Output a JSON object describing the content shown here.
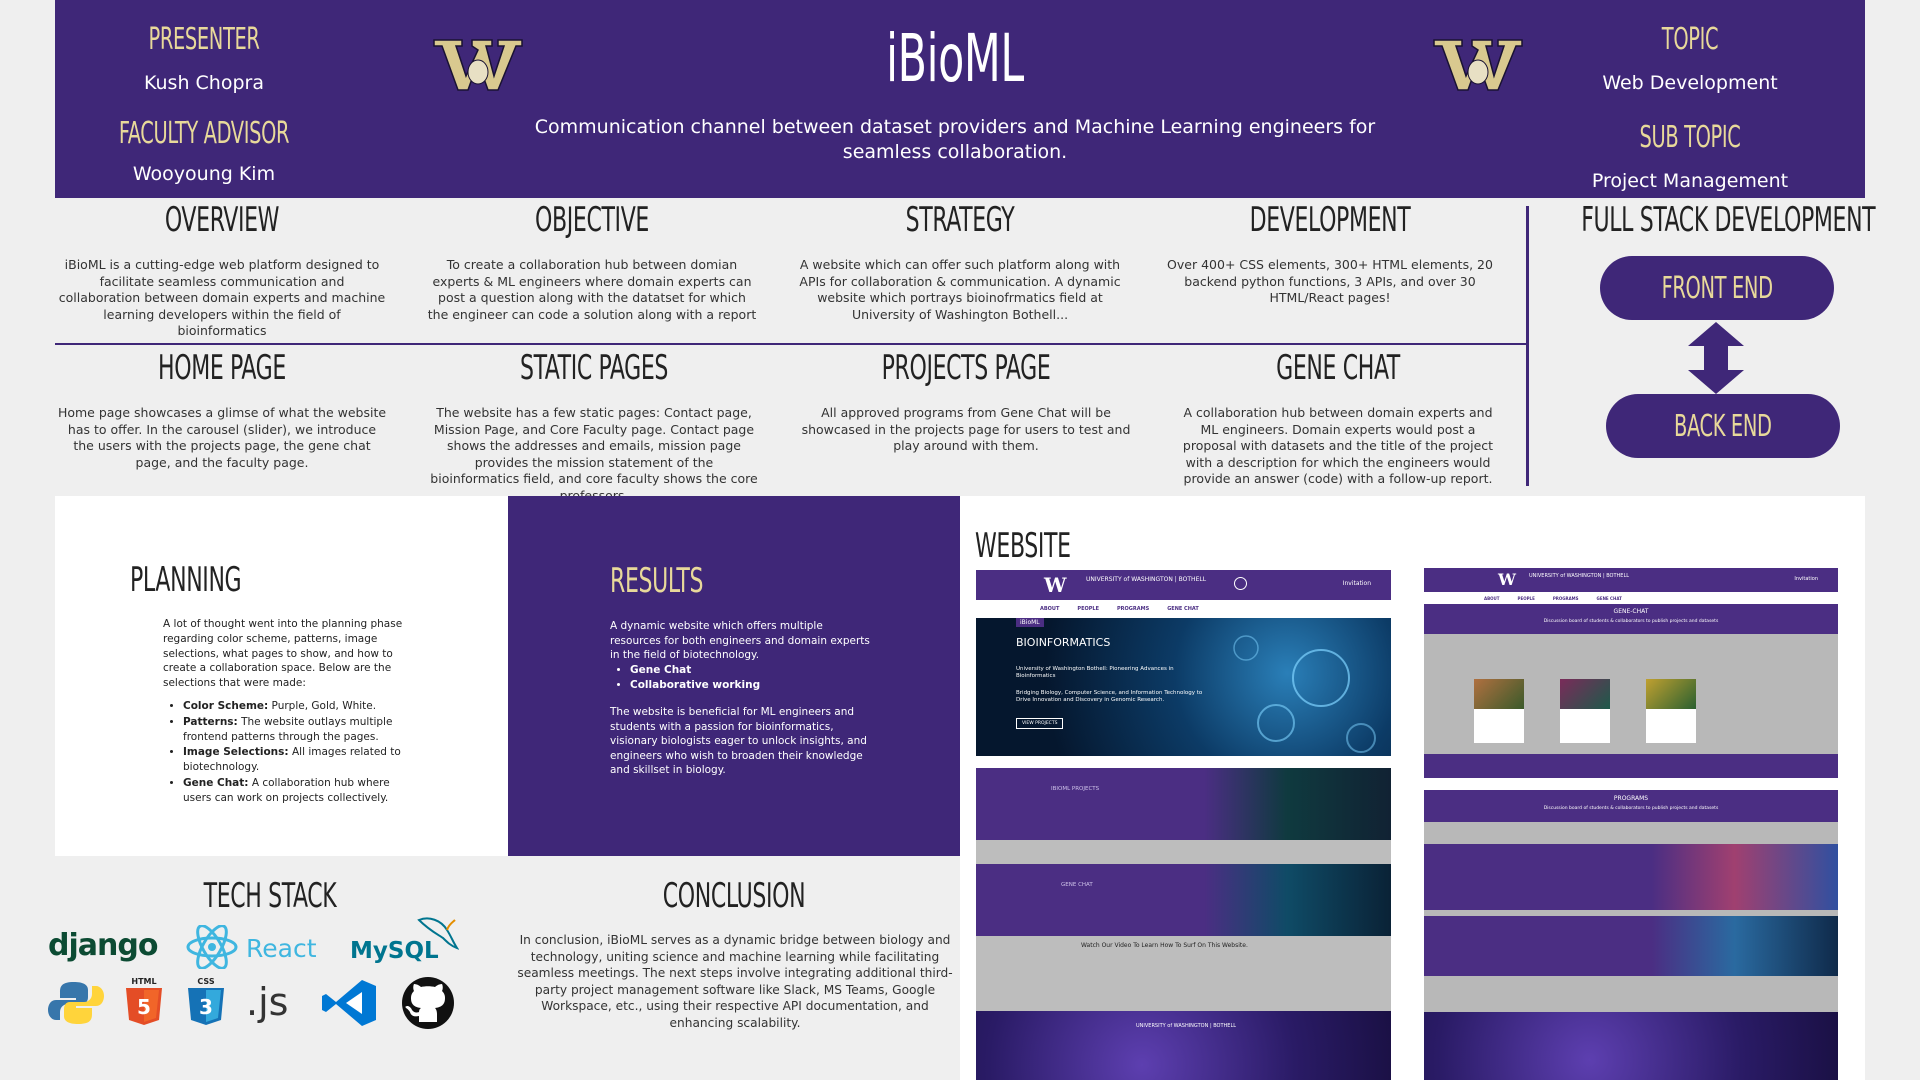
{
  "header": {
    "presenter_label": "PRESENTER",
    "presenter_name": "Kush Chopra",
    "advisor_label": "FACULTY ADVISOR",
    "advisor_name": "Wooyoung Kim",
    "title": "iBioML",
    "subtitle": "Communication channel between dataset providers and Machine Learning engineers for seamless collaboration.",
    "topic_label": "TOPIC",
    "topic_value": "Web Development",
    "subtopic_label": "SUB TOPIC",
    "subtopic_value": "Project Management",
    "logo_icon": "uw-husky-w-icon"
  },
  "row1": [
    {
      "title": "OVERVIEW",
      "body": "iBioML is a cutting-edge web platform designed to facilitate seamless communication and collaboration between domain experts and machine learning developers within the field of bioinformatics"
    },
    {
      "title": "OBJECTIVE",
      "body": "To create a collaboration hub between domian experts & ML engineers where domain experts can post a question along with the datatset for which the engineer can code a solution along with a report"
    },
    {
      "title": "STRATEGY",
      "body": "A website which can offer such platform along with APIs for collaboration & communication. A dynamic website which portrays bioinofrmatics field at University of Washington Bothell..."
    },
    {
      "title": "DEVELOPMENT",
      "body": "Over 400+ CSS elements, 300+ HTML elements, 20 backend python functions, 3 APIs, and over 30 HTML/React pages!"
    }
  ],
  "row2": [
    {
      "title": "HOME PAGE",
      "body": "Home page showcases a glimse of what the website has to offer. In the carousel (slider), we introduce the users with the projects page, the gene chat page, and the faculty page."
    },
    {
      "title": "STATIC PAGES",
      "body": "The website has a few static pages: Contact page, Mission Page, and Core Faculty page. Contact page shows the addresses and emails, mission page provides the mission statement of the bioinformatics field, and core faculty shows the core professors."
    },
    {
      "title": "PROJECTS PAGE",
      "body": "All approved programs from Gene Chat will be showcased in the projects page for users to test and play around with them."
    },
    {
      "title": "GENE CHAT",
      "body": "A collaboration hub between domain experts and ML engineers. Domain experts would post a proposal with datasets and the title of the project with a description for which the engineers would provide an answer (code) with a follow-up report."
    }
  ],
  "fullstack": {
    "title": "FULL STACK DEVELOPMENT",
    "front_end": "FRONT END",
    "back_end": "BACK END"
  },
  "planning": {
    "title": "PLANNING",
    "intro": "A lot of thought went into the planning phase regarding color scheme, patterns, image selections, what pages to show, and how to create a collaboration space. Below are the selections that were made:",
    "items": [
      {
        "label": "Color Scheme:",
        "text": " Purple, Gold, White."
      },
      {
        "label": "Patterns:",
        "text": " The website outlays multiple frontend patterns through the pages."
      },
      {
        "label": "Image Selections:",
        "text": " All images related to biotechnology."
      },
      {
        "label": "Gene Chat:",
        "text": " A collaboration hub where users can work on projects collectively."
      }
    ]
  },
  "results": {
    "title": "RESULTS",
    "intro": "A dynamic website which offers multiple resources for both engineers and domain experts in the field of biotechnology.",
    "bullets": [
      "Gene Chat",
      "Collaborative working"
    ],
    "body": "The website is beneficial for ML engineers and students with a passion for bioinformatics, visionary biologists eager to unlock insights, and engineers who wish to broaden their knowledge and skillset in biology."
  },
  "website": {
    "title": "WEBSITE",
    "uw_name": "UNIVERSITY of WASHINGTON | BOTHELL",
    "nav": [
      "ABOUT",
      "PEOPLE",
      "PROGRAMS",
      "GENE CHAT"
    ],
    "hero_tag": "iBioML",
    "hero_title": "BIOINFORMATICS",
    "hero_line1": "University of Washington Bothell: Pioneering Advances in Bioinformatics",
    "hero_line2": "Bridging Biology, Computer Science, and Information Technology to Drive Innovation and Discovery in Genomic Research.",
    "hero_button": "VIEW PROJECTS",
    "band1": "IBIOML PROJECTS",
    "band2": "GENE CHAT",
    "video_text": "Watch Our Video To Learn How To Surf On This Website.",
    "gene_chat_header": "GENE-CHAT",
    "gene_chat_sub": "Discussion board of students & collaborators to publish projects and datasets",
    "programs_header": "PROGRAMS",
    "programs_sub": "Discussion board of students & collaborators to publish projects and datasets",
    "login": "Invitation"
  },
  "techstack": {
    "title": "TECH STACK",
    "logos": [
      "django",
      "React",
      "MySQL"
    ],
    "icons": [
      "python-icon",
      "html5-icon",
      "css3-icon",
      "js-icon",
      "vscode-icon",
      "github-icon"
    ]
  },
  "conclusion": {
    "title": "CONCLUSION",
    "body": "In conclusion, iBioML serves as a dynamic bridge between biology and technology, uniting science and machine learning while facilitating seamless meetings. The next steps involve integrating additional third-party project management software like Slack, MS Teams, Google Workspace, etc., using their respective API documentation, and enhancing scalability."
  },
  "colors": {
    "purple": "#3f2778",
    "gold": "#e8d99a",
    "background": "#efefef"
  }
}
